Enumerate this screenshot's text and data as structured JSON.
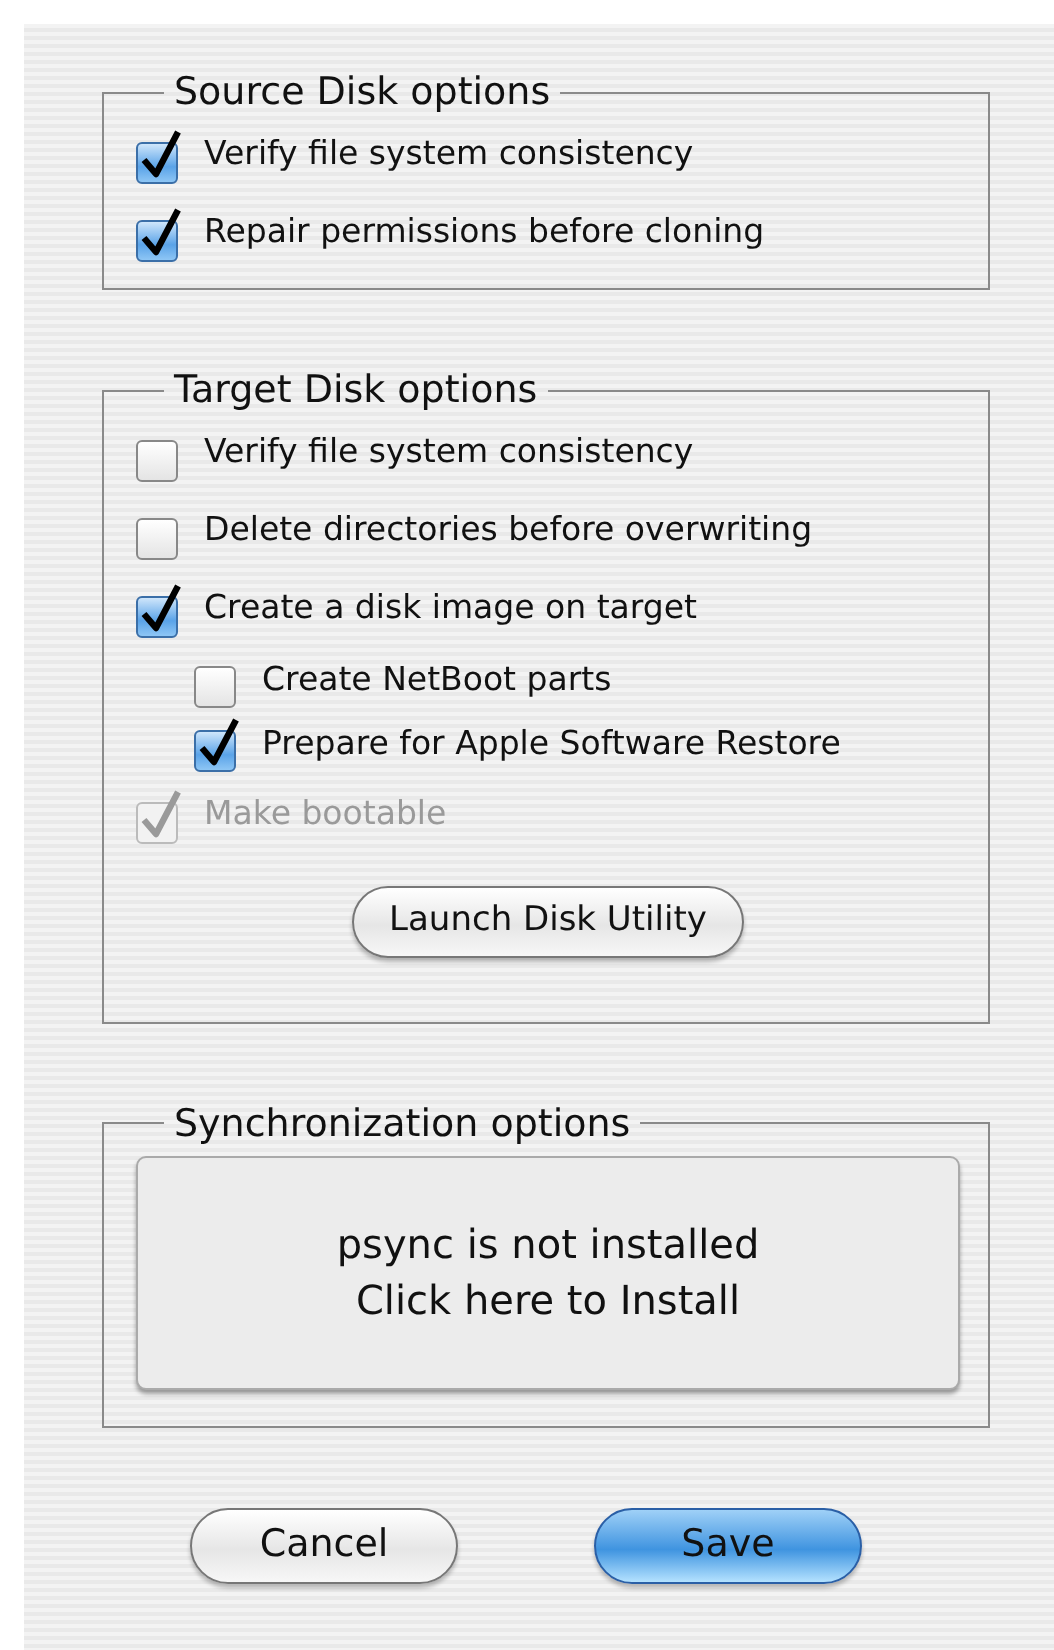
{
  "groups": [
    {
      "title": "Source Disk options",
      "options": [
        {
          "label": "Verify file system consistency",
          "checked": true,
          "disabled": false
        },
        {
          "label": "Repair permissions before cloning",
          "checked": true,
          "disabled": false
        }
      ]
    },
    {
      "title": "Target Disk options",
      "options": [
        {
          "label": "Verify file system consistency",
          "checked": false,
          "disabled": false
        },
        {
          "label": "Delete directories before overwriting",
          "checked": false,
          "disabled": false
        },
        {
          "label": "Create a disk image on target",
          "checked": true,
          "disabled": false,
          "children": [
            {
              "label": "Create NetBoot parts",
              "checked": false,
              "disabled": false
            },
            {
              "label": "Prepare for Apple Software Restore",
              "checked": true,
              "disabled": false
            }
          ]
        },
        {
          "label": "Make bootable",
          "checked": true,
          "disabled": true
        }
      ],
      "button": "Launch Disk Utility"
    },
    {
      "title": "Synchronization options",
      "install_button": [
        "psync is not installed",
        "Click here to Install"
      ]
    }
  ],
  "buttons": [
    {
      "label": "Cancel",
      "default": false
    },
    {
      "label": "Save",
      "default": true
    }
  ]
}
